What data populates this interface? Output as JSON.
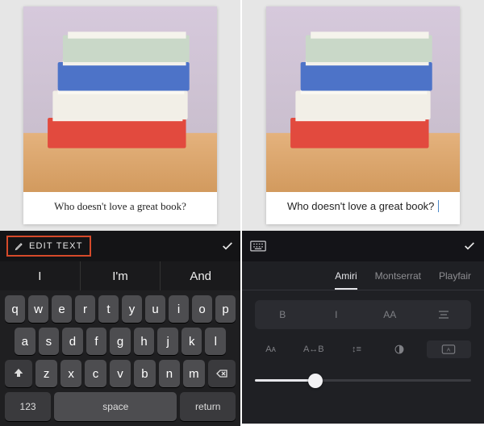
{
  "caption_left": "Who doesn't love a great book?",
  "caption_right": "Who doesn't love a great book?",
  "left": {
    "edit_label": "EDIT TEXT",
    "suggestions": [
      "I",
      "I'm",
      "And"
    ],
    "row1": [
      "q",
      "w",
      "e",
      "r",
      "t",
      "y",
      "u",
      "i",
      "o",
      "p"
    ],
    "row2": [
      "a",
      "s",
      "d",
      "f",
      "g",
      "h",
      "j",
      "k",
      "l"
    ],
    "row3": [
      "z",
      "x",
      "c",
      "v",
      "b",
      "n",
      "m"
    ],
    "num_key": "123",
    "space_key": "space",
    "return_key": "return"
  },
  "right": {
    "fonts": [
      "Amiri",
      "Montserrat",
      "Playfair"
    ],
    "active_font_index": 0,
    "style_row": {
      "bold": "B",
      "italic": "I",
      "caps": "AA"
    },
    "size_label": "Aᴀ",
    "spacing_label": "A↔B",
    "lineheight": "↕≡",
    "slider_value_pct": 28
  }
}
